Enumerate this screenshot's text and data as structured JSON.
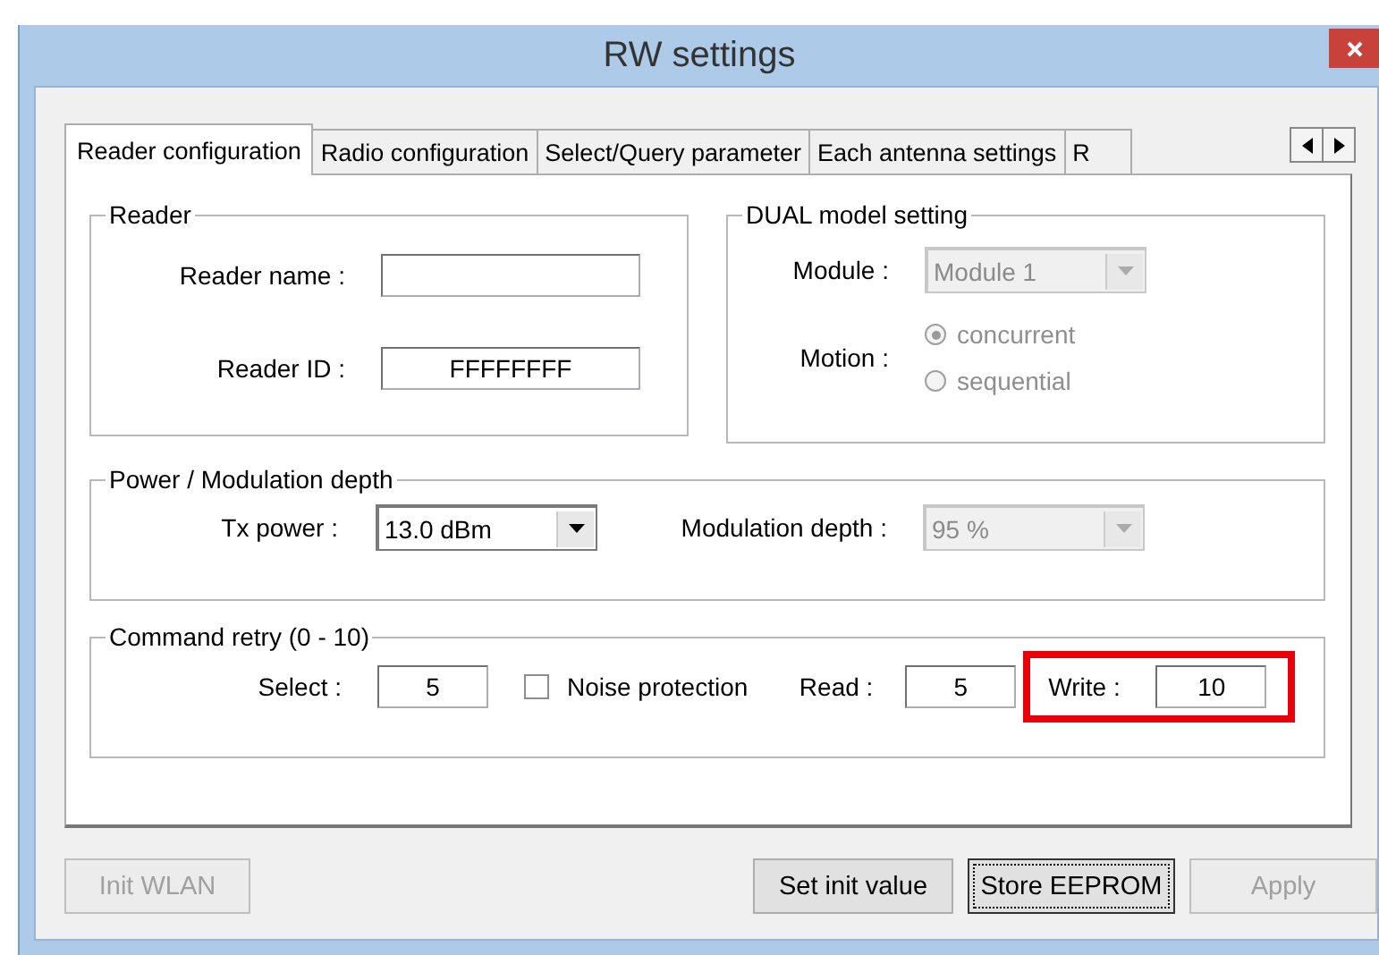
{
  "window": {
    "title": "RW settings"
  },
  "tabs": [
    {
      "label": "Reader configuration",
      "selected": true
    },
    {
      "label": "Radio configuration",
      "selected": false
    },
    {
      "label": "Select/Query parameter",
      "selected": false
    },
    {
      "label": "Each antenna settings",
      "selected": false
    },
    {
      "label": "R",
      "selected": false
    }
  ],
  "reader": {
    "title": "Reader",
    "fields": [
      {
        "label": "Reader name :"
      },
      {
        "label": "Reader ID :",
        "value": "FFFFFFFF"
      }
    ]
  },
  "dual": {
    "title": "DUAL model setting",
    "module": {
      "label": "Module :",
      "value": "Module 1",
      "disabled": true
    },
    "motion": {
      "label": "Motion :",
      "disabled": true,
      "options": [
        {
          "label": "concurrent",
          "selected": true
        },
        {
          "label": "sequential",
          "selected": false
        }
      ]
    }
  },
  "power": {
    "title": "Power / Modulation depth",
    "tx_power": {
      "label": "Tx power :",
      "value": "13.0 dBm",
      "disabled": false
    },
    "modulation": {
      "label": "Modulation depth :",
      "value": "95 %",
      "disabled": true
    }
  },
  "retry": {
    "title": "Command retry (0 - 10)",
    "select": {
      "label": "Select :",
      "value": "5"
    },
    "noise": {
      "label": "Noise protection",
      "checked": false
    },
    "read": {
      "label": "Read :",
      "value": "5"
    },
    "write": {
      "label": "Write :",
      "value": "10",
      "highlighted": true
    }
  },
  "buttons": [
    {
      "label": "Init WLAN",
      "disabled": true,
      "focused": false
    },
    {
      "label": "Set init value",
      "disabled": false,
      "focused": false
    },
    {
      "label": "Store EEPROM",
      "disabled": false,
      "focused": true
    },
    {
      "label": "Apply",
      "disabled": true,
      "focused": false
    }
  ]
}
